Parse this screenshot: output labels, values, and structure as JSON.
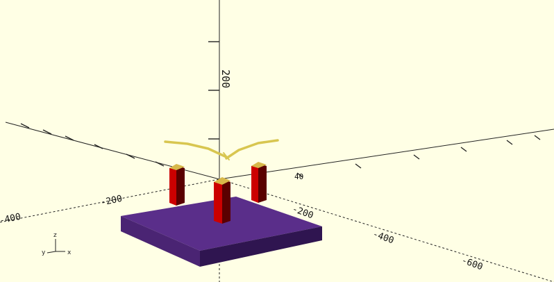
{
  "viewport": {
    "background": "#ffffe5",
    "axis_color": "#222222",
    "labels": {
      "z_label": "200",
      "neg_x_label": "-200",
      "neg_x_far_label": "-400",
      "y_near_label": "-200",
      "y_mid_label": "-400",
      "y_far_label": "-600",
      "pos_small_label": "40"
    }
  },
  "axis_gizmo": {
    "x": "x",
    "y": "y",
    "z": "z"
  },
  "colors": {
    "base_top": "#5a2e8a",
    "base_side": "#3b1a5e",
    "post_red": "#cc0000",
    "post_dark": "#5a0000",
    "post_cap": "#d7b84a",
    "wings": "#d8c650"
  }
}
